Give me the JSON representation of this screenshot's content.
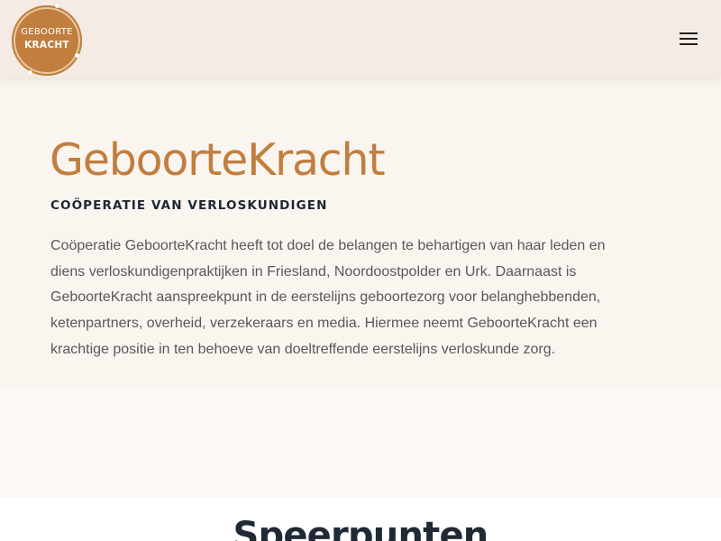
{
  "header": {
    "logo": {
      "line1": "GEBOORTE",
      "line2": "KRACHT"
    },
    "menu_icon": "hamburger-menu-icon"
  },
  "hero": {
    "title": "GeboorteKracht",
    "subtitle": "COÖPERATIE VAN VERLOSKUNDIGEN",
    "text": "Coöperatie GeboorteKracht heeft tot doel de belangen te behartigen van haar leden en diens verloskundigenpraktijken in Friesland, Noordoostpolder en Urk. Daarnaast is GeboorteKracht aanspreekpunt in de eerstelijns geboortezorg voor belanghebbenden, ketenpartners, overheid, verzekeraars en media. Hiermee neemt GeboorteKracht een krachtige positie in ten behoeve van doeltreffende eerstelijns verloskunde zorg."
  },
  "section": {
    "title": "Speerpunten"
  },
  "colors": {
    "accent": "#c17e3f",
    "header_bg": "#f3ebe4",
    "hero_bg": "#fbf5f0",
    "heading_dark": "#1d2733",
    "body_text": "#585858"
  }
}
